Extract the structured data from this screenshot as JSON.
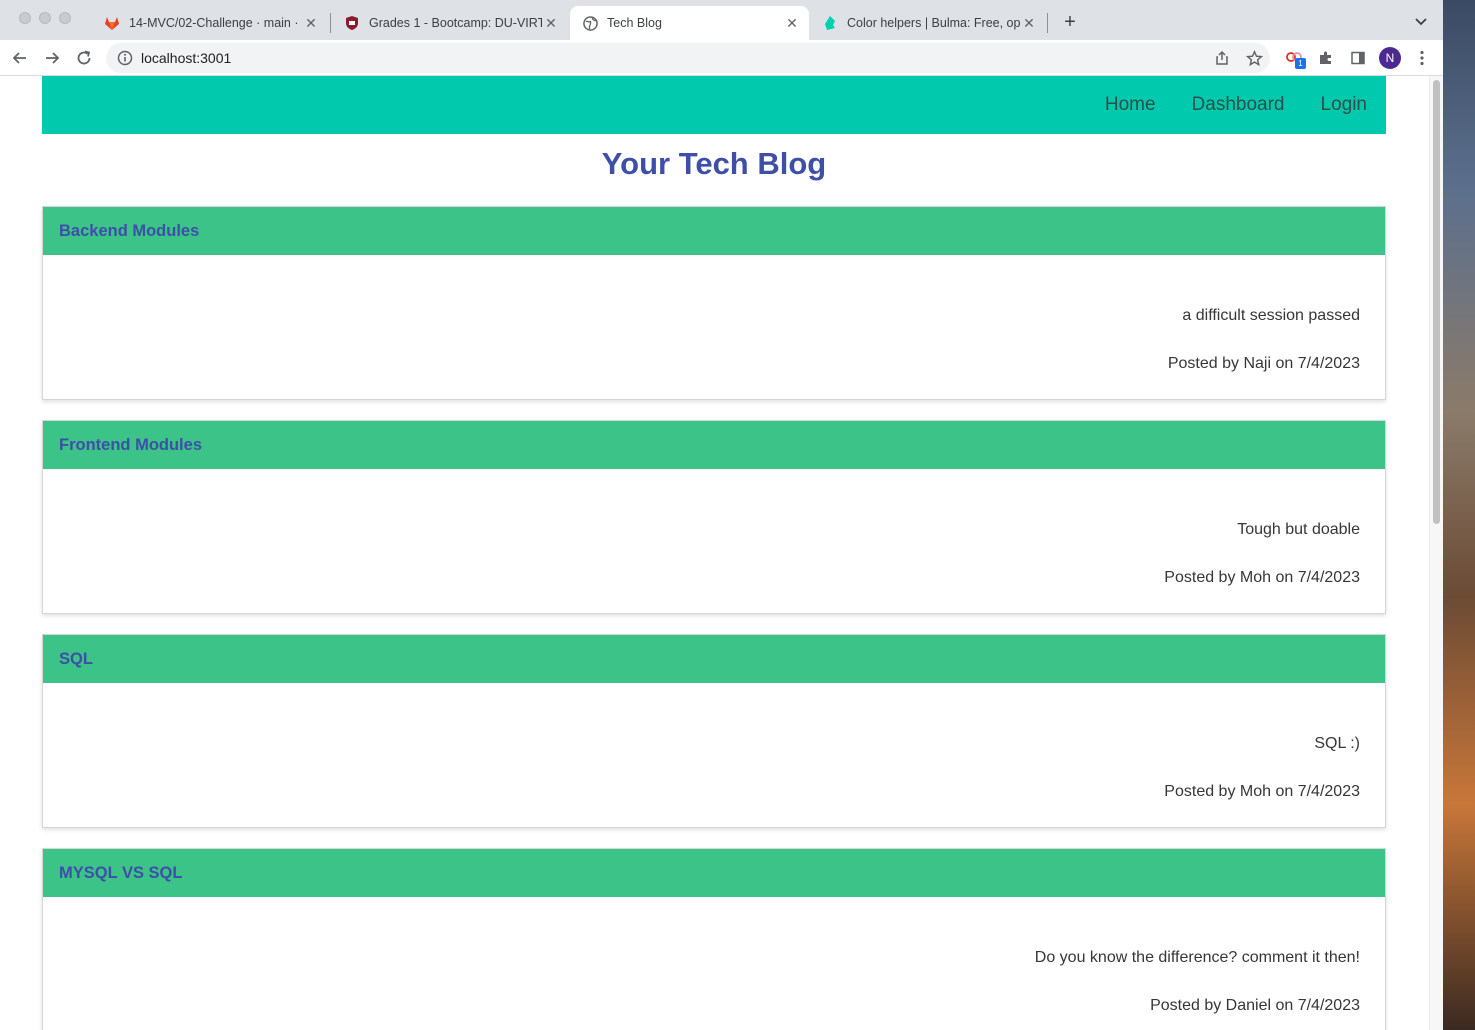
{
  "browser": {
    "tabs": [
      {
        "title": "14-MVC/02-Challenge · main ·",
        "active": false,
        "icon": "gitlab-icon"
      },
      {
        "title": "Grades 1 - Bootcamp: DU-VIRT",
        "active": false,
        "icon": "shield-icon"
      },
      {
        "title": "Tech Blog",
        "active": true,
        "icon": "globe-icon"
      },
      {
        "title": "Color helpers | Bulma: Free, op",
        "active": false,
        "icon": "bulma-icon"
      }
    ],
    "url": "localhost:3001",
    "extension_badge": "1",
    "profile_initial": "N"
  },
  "nav": {
    "home": "Home",
    "dashboard": "Dashboard",
    "login": "Login"
  },
  "page_title": "Your Tech Blog",
  "posts": [
    {
      "title": "Backend Modules",
      "content": "a difficult session passed",
      "meta": "Posted by Naji on 7/4/2023"
    },
    {
      "title": "Frontend Modules",
      "content": "Tough but doable",
      "meta": "Posted by Moh on 7/4/2023"
    },
    {
      "title": "SQL",
      "content": "SQL :)",
      "meta": "Posted by Moh on 7/4/2023"
    },
    {
      "title": "MYSQL VS SQL",
      "content": "Do you know the difference? comment it then!",
      "meta": "Posted by Daniel on 7/4/2023"
    }
  ],
  "colors": {
    "navbar": "#00c9ad",
    "post_header": "#3cc387",
    "title": "#3e4fa8"
  }
}
